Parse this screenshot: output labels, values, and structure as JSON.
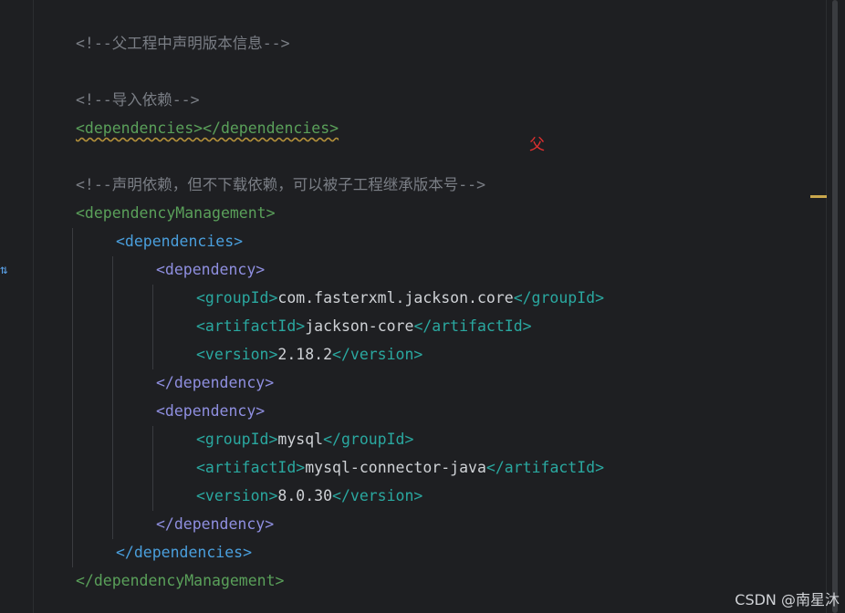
{
  "editor": {
    "lines": [
      {
        "parts": [
          {
            "t": "<!--父工程中声明版本信息-->",
            "c": "cm"
          }
        ]
      },
      {
        "parts": []
      },
      {
        "parts": [
          {
            "t": "<!--导入依赖-->",
            "c": "cm"
          }
        ]
      },
      {
        "parts": [
          {
            "t": "<dependencies></dependencies>",
            "c": "tag squig"
          }
        ]
      },
      {
        "parts": []
      },
      {
        "parts": [
          {
            "t": "<!--声明依赖，但不下载依赖，可以被子工程继承版本号-->",
            "c": "cm"
          }
        ]
      },
      {
        "parts": [
          {
            "t": "<dependencyManagement>",
            "c": "tag"
          }
        ]
      },
      {
        "parts": [
          {
            "t": "<dependencies>",
            "c": "tag2"
          }
        ]
      },
      {
        "parts": [
          {
            "t": "<dependency>",
            "c": "tag3"
          }
        ]
      },
      {
        "parts": [
          {
            "t": "<groupId>",
            "c": "tag4"
          },
          {
            "t": "com.fasterxml.jackson.core",
            "c": "txt"
          },
          {
            "t": "</groupId>",
            "c": "tag4"
          }
        ]
      },
      {
        "parts": [
          {
            "t": "<artifactId>",
            "c": "tag4"
          },
          {
            "t": "jackson-core",
            "c": "txt"
          },
          {
            "t": "</artifactId>",
            "c": "tag4"
          }
        ]
      },
      {
        "parts": [
          {
            "t": "<version>",
            "c": "tag4"
          },
          {
            "t": "2.18.2",
            "c": "txt"
          },
          {
            "t": "</version>",
            "c": "tag4"
          }
        ]
      },
      {
        "parts": [
          {
            "t": "</dependency>",
            "c": "tag3"
          }
        ]
      },
      {
        "parts": [
          {
            "t": "<dependency>",
            "c": "tag3"
          }
        ]
      },
      {
        "parts": [
          {
            "t": "<groupId>",
            "c": "tag4"
          },
          {
            "t": "mysql",
            "c": "txt"
          },
          {
            "t": "</groupId>",
            "c": "tag4"
          }
        ]
      },
      {
        "parts": [
          {
            "t": "<artifactId>",
            "c": "tag4"
          },
          {
            "t": "mysql-connector-java",
            "c": "txt"
          },
          {
            "t": "</artifactId>",
            "c": "tag4"
          }
        ]
      },
      {
        "parts": [
          {
            "t": "<version>",
            "c": "tag4"
          },
          {
            "t": "8.0.30",
            "c": "txt"
          },
          {
            "t": "</version>",
            "c": "tag4"
          }
        ]
      },
      {
        "parts": [
          {
            "t": "</dependency>",
            "c": "tag3"
          }
        ]
      },
      {
        "parts": [
          {
            "t": "</dependencies>",
            "c": "tag2"
          }
        ]
      },
      {
        "parts": [
          {
            "t": "</dependencyManagement>",
            "c": "tag"
          }
        ]
      }
    ]
  },
  "annotation": {
    "text": "父"
  },
  "watermark": {
    "text": "CSDN @南星沐"
  },
  "colors": {
    "comment": "#7a7e85",
    "tag_outer": "#5aa05a",
    "tag_dependencies": "#4a9fdd",
    "tag_dependency": "#8f8fe0",
    "tag_leaf": "#2aa8a0",
    "text": "#cfd2d6",
    "background": "#1e1f22",
    "annotation": "#e03030"
  },
  "icons": {
    "gutter": "implementation-arrow-icon"
  }
}
